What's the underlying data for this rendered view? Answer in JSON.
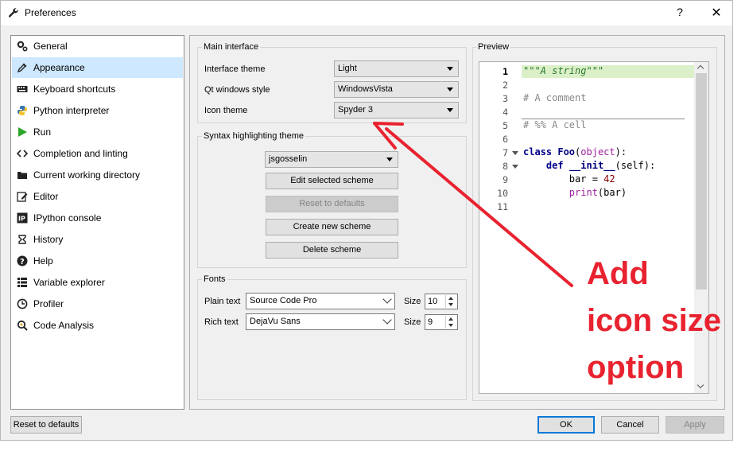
{
  "window": {
    "title": "Preferences",
    "help": "?",
    "close": "✕"
  },
  "sidebar": {
    "items": [
      {
        "label": "General",
        "icon": "gears-icon"
      },
      {
        "label": "Appearance",
        "icon": "eyedropper-icon",
        "selected": true
      },
      {
        "label": "Keyboard shortcuts",
        "icon": "keyboard-icon"
      },
      {
        "label": "Python interpreter",
        "icon": "python-icon"
      },
      {
        "label": "Run",
        "icon": "play-icon"
      },
      {
        "label": "Completion and linting",
        "icon": "code-brackets-icon"
      },
      {
        "label": "Current working directory",
        "icon": "folder-icon"
      },
      {
        "label": "Editor",
        "icon": "edit-icon"
      },
      {
        "label": "IPython console",
        "icon": "ipython-icon"
      },
      {
        "label": "History",
        "icon": "history-icon"
      },
      {
        "label": "Help",
        "icon": "question-icon"
      },
      {
        "label": "Variable explorer",
        "icon": "table-icon"
      },
      {
        "label": "Profiler",
        "icon": "clock-icon"
      },
      {
        "label": "Code Analysis",
        "icon": "magnifier-icon"
      }
    ]
  },
  "main_interface": {
    "title": "Main interface",
    "interface_theme_label": "Interface theme",
    "interface_theme_value": "Light",
    "qt_style_label": "Qt windows style",
    "qt_style_value": "WindowsVista",
    "icon_theme_label": "Icon theme",
    "icon_theme_value": "Spyder 3"
  },
  "syntax": {
    "title": "Syntax highlighting theme",
    "scheme_value": "jsgosselin",
    "edit_button": "Edit selected scheme",
    "reset_button": "Reset to defaults",
    "create_button": "Create new scheme",
    "delete_button": "Delete scheme"
  },
  "fonts": {
    "title": "Fonts",
    "plain_label": "Plain text",
    "plain_value": "Source Code Pro",
    "plain_size_label": "Size",
    "plain_size": "10",
    "rich_label": "Rich text",
    "rich_value": "DejaVu Sans",
    "rich_size_label": "Size",
    "rich_size": "9"
  },
  "preview": {
    "title": "Preview",
    "line_numbers": [
      "1",
      "2",
      "3",
      "4",
      "5",
      "6",
      "7",
      "8",
      "9",
      "10",
      "11"
    ],
    "code": {
      "l1": "\"\"\"A string\"\"\"",
      "l3": "# A comment",
      "l5": "# %% A cell",
      "l7_kw": "class",
      "l7_name": "Foo",
      "l7_open": "(",
      "l7_base": "object",
      "l7_close": "):",
      "l8_kw": "def",
      "l8_name": "__init__",
      "l8_args": "(self):",
      "l9_var": "bar = ",
      "l9_num": "42",
      "l10_fn": "print",
      "l10_args": "(bar)"
    }
  },
  "footer": {
    "reset": "Reset to defaults",
    "ok": "OK",
    "cancel": "Cancel",
    "apply": "Apply"
  },
  "annotation": {
    "line1": "Add",
    "line2": "icon size",
    "line3": "option",
    "color": "#e8232f"
  }
}
